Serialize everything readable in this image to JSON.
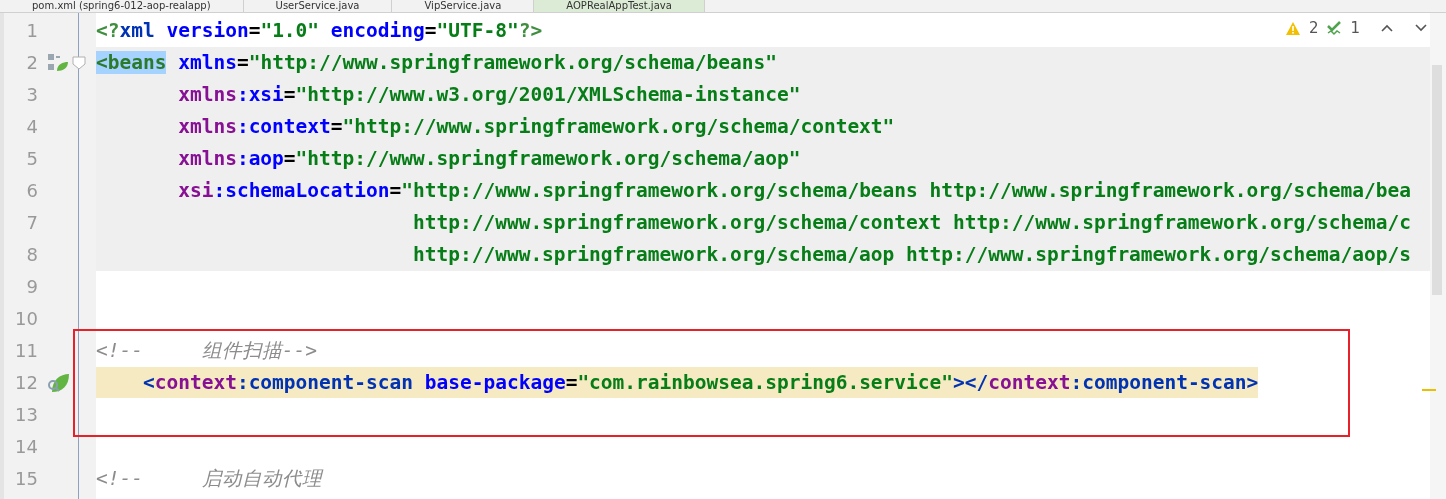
{
  "tabs": [
    {
      "label": "pom.xml (spring6-012-aop-realapp)",
      "selected": false
    },
    {
      "label": "UserService.java",
      "selected": false
    },
    {
      "label": "VipService.java",
      "selected": false
    },
    {
      "label": "AOPRealAppTest.java",
      "selected": true
    }
  ],
  "inspections": {
    "warnings": "2",
    "weak_warnings": "1"
  },
  "lines": [
    {
      "number": "1",
      "kind": "plain",
      "annotated": false,
      "tokens": [
        {
          "kind": "punct",
          "text": "<?"
        },
        {
          "kind": "tag",
          "text": "xml"
        },
        {
          "kind": "attr",
          "text": " version"
        },
        {
          "kind": "text",
          "text": "="
        },
        {
          "kind": "value",
          "text": "\"1.0\""
        },
        {
          "kind": "attr",
          "text": " encoding"
        },
        {
          "kind": "text",
          "text": "="
        },
        {
          "kind": "value",
          "text": "\"UTF-8\""
        },
        {
          "kind": "punct",
          "text": "?>"
        }
      ]
    },
    {
      "number": "2",
      "kind": "bean-root",
      "annotated": false,
      "tokens": [
        {
          "kind": "selected",
          "text": "<beans"
        },
        {
          "kind": "attr",
          "text": " xmlns"
        },
        {
          "kind": "text",
          "text": "="
        },
        {
          "kind": "value",
          "text": "\"http://www.springframework.org/schema/beans\""
        }
      ]
    },
    {
      "number": "3",
      "kind": "shaded",
      "annotated": false,
      "tokens": [
        {
          "kind": "ns",
          "text": "       xmlns"
        },
        {
          "kind": "attr",
          "text": ":xsi"
        },
        {
          "kind": "text",
          "text": "="
        },
        {
          "kind": "value",
          "text": "\"http://www.w3.org/2001/XMLSchema-instance\""
        }
      ]
    },
    {
      "number": "4",
      "kind": "shaded",
      "annotated": false,
      "tokens": [
        {
          "kind": "ns",
          "text": "       xmlns"
        },
        {
          "kind": "attr",
          "text": ":context"
        },
        {
          "kind": "text",
          "text": "="
        },
        {
          "kind": "value",
          "text": "\"http://www.springframework.org/schema/context\""
        }
      ]
    },
    {
      "number": "5",
      "kind": "shaded",
      "annotated": false,
      "tokens": [
        {
          "kind": "ns",
          "text": "       xmlns"
        },
        {
          "kind": "attr",
          "text": ":aop"
        },
        {
          "kind": "text",
          "text": "="
        },
        {
          "kind": "value",
          "text": "\"http://www.springframework.org/schema/aop\""
        }
      ]
    },
    {
      "number": "6",
      "kind": "shaded",
      "annotated": false,
      "tokens": [
        {
          "kind": "ns",
          "text": "       xsi"
        },
        {
          "kind": "attr",
          "text": ":schemaLocation"
        },
        {
          "kind": "text",
          "text": "="
        },
        {
          "kind": "value",
          "text": "\"http://www.springframework.org/schema/beans http://www.springframework.org/schema/bea"
        }
      ]
    },
    {
      "number": "7",
      "kind": "shaded",
      "annotated": false,
      "tokens": [
        {
          "kind": "value",
          "text": "                           http://www.springframework.org/schema/context http://www.springframework.org/schema/c"
        }
      ]
    },
    {
      "number": "8",
      "kind": "shaded",
      "annotated": false,
      "tokens": [
        {
          "kind": "value",
          "text": "                           http://www.springframework.org/schema/aop http://www.springframework.org/schema/aop/s"
        }
      ]
    },
    {
      "number": "9",
      "kind": "plain",
      "annotated": false
    },
    {
      "number": "10",
      "kind": "plain",
      "annotated": false
    },
    {
      "number": "11",
      "kind": "plain",
      "annotated": true,
      "tokens": [
        {
          "kind": "comment",
          "text": "<!--     组件扫描-->"
        }
      ]
    },
    {
      "number": "12",
      "kind": "scan",
      "annotated": true,
      "tokens": [
        {
          "kind": "punct2",
          "text": "    <"
        },
        {
          "kind": "ns",
          "text": "context"
        },
        {
          "kind": "tag",
          "text": ":component-scan"
        },
        {
          "kind": "attr",
          "text": " base-package"
        },
        {
          "kind": "text",
          "text": "="
        },
        {
          "kind": "value",
          "text": "\"com.rainbowsea.spring6.service\""
        },
        {
          "kind": "punct2",
          "text": "></"
        },
        {
          "kind": "ns",
          "text": "context"
        },
        {
          "kind": "tag",
          "text": ":component-scan"
        },
        {
          "kind": "punct2",
          "text": ">"
        }
      ]
    },
    {
      "number": "13",
      "kind": "plain",
      "annotated": true
    },
    {
      "number": "14",
      "kind": "plain",
      "annotated": false
    },
    {
      "number": "15",
      "kind": "plain",
      "annotated": false,
      "tokens": [
        {
          "kind": "comment",
          "text": "<!--     启动自动代理"
        }
      ]
    }
  ]
}
